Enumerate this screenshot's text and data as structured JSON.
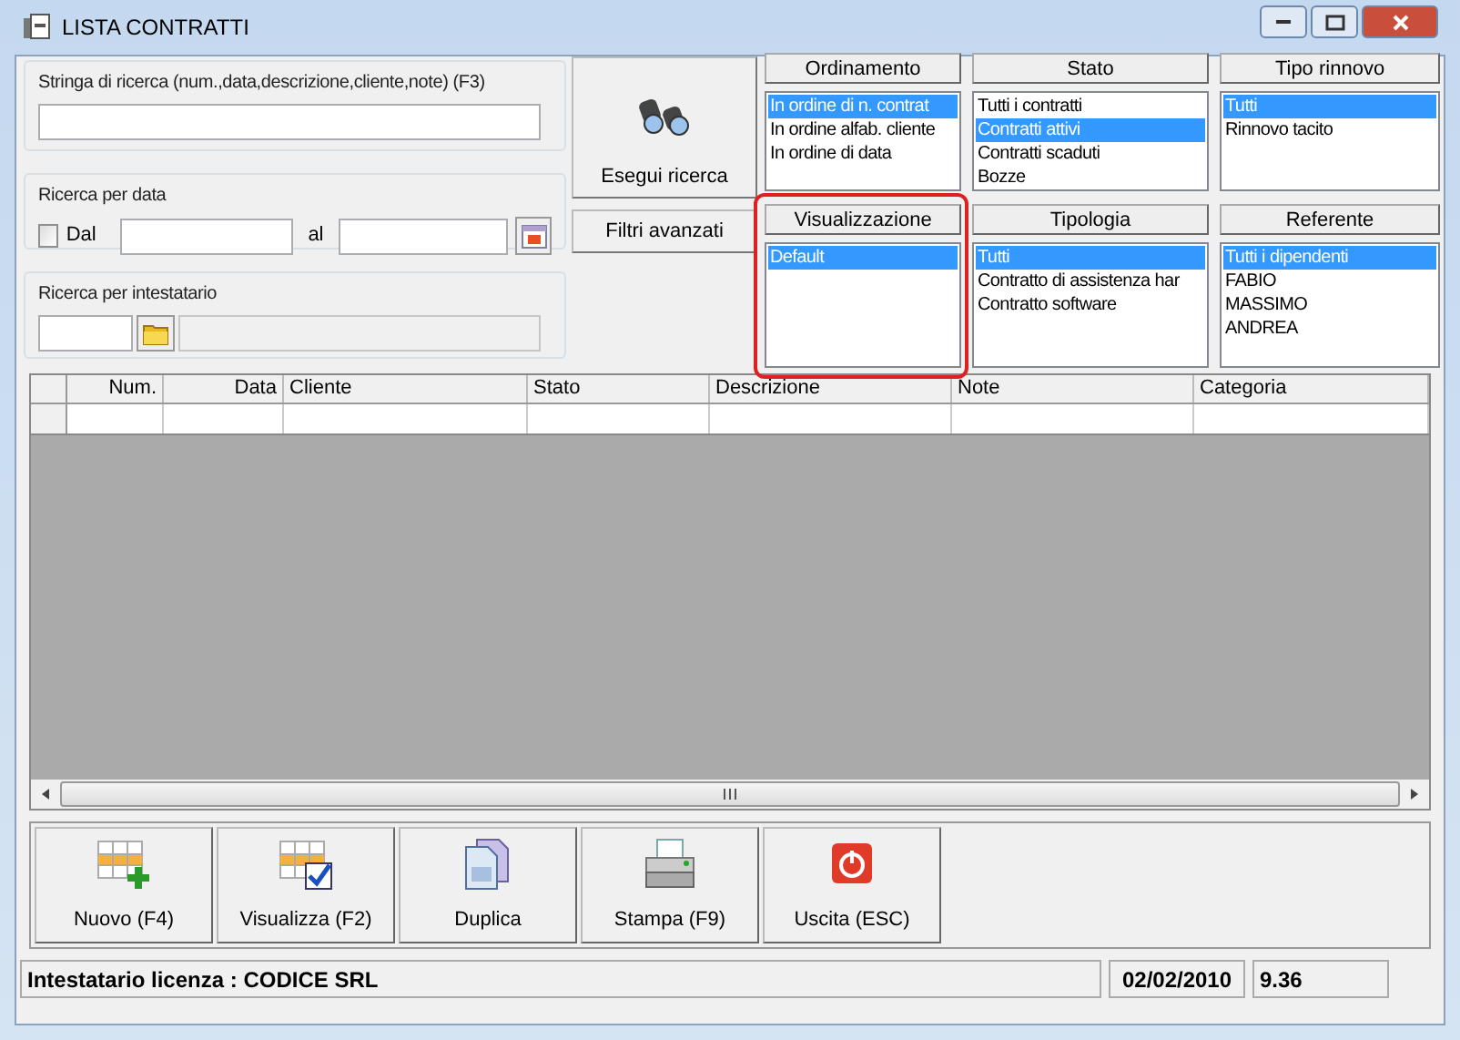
{
  "window": {
    "title": "LISTA CONTRATTI"
  },
  "search": {
    "label": "Stringa di ricerca (num.,data,descrizione,cliente,note) (F3)"
  },
  "date_search": {
    "label": "Ricerca per data",
    "checkbox_label": "Dal",
    "checked": false,
    "to_label": "al"
  },
  "holder_search": {
    "label": "Ricerca per intestatario"
  },
  "search_button": "Esegui ricerca",
  "advanced_button": "Filtri avanzati",
  "filters": [
    {
      "title": "Ordinamento",
      "highlighted": false,
      "items": [
        {
          "label": "In ordine di n. contrat",
          "selected": true
        },
        {
          "label": "In ordine alfab. cliente",
          "selected": false
        },
        {
          "label": "In ordine di data",
          "selected": false
        }
      ]
    },
    {
      "title": "Stato",
      "highlighted": false,
      "items": [
        {
          "label": "Tutti i contratti",
          "selected": false
        },
        {
          "label": "Contratti attivi",
          "selected": true
        },
        {
          "label": "Contratti scaduti",
          "selected": false
        },
        {
          "label": "Bozze",
          "selected": false
        }
      ]
    },
    {
      "title": "Tipo rinnovo",
      "highlighted": false,
      "items": [
        {
          "label": "Tutti",
          "selected": true
        },
        {
          "label": "Rinnovo tacito",
          "selected": false
        }
      ]
    },
    {
      "title": "Visualizzazione",
      "highlighted": true,
      "items": [
        {
          "label": "Default",
          "selected": true
        }
      ]
    },
    {
      "title": "Tipologia",
      "highlighted": false,
      "items": [
        {
          "label": "Tutti",
          "selected": true
        },
        {
          "label": "Contratto di assistenza har",
          "selected": false
        },
        {
          "label": "Contratto software",
          "selected": false
        }
      ]
    },
    {
      "title": "Referente",
      "highlighted": false,
      "items": [
        {
          "label": "Tutti i dipendenti",
          "selected": true
        },
        {
          "label": "FABIO",
          "selected": false
        },
        {
          "label": "MASSIMO",
          "selected": false
        },
        {
          "label": "ANDREA",
          "selected": false
        }
      ]
    }
  ],
  "table": {
    "columns": [
      "Num.",
      "Data",
      "Cliente",
      "Stato",
      "Descrizione",
      "Note",
      "Categoria"
    ]
  },
  "toolbar": [
    {
      "kind": "new",
      "label": "Nuovo (F4)"
    },
    {
      "kind": "view",
      "label": "Visualizza (F2)"
    },
    {
      "kind": "duplicate",
      "label": "Duplica"
    },
    {
      "kind": "print",
      "label": "Stampa (F9)"
    },
    {
      "kind": "exit",
      "label": "Uscita (ESC)"
    }
  ],
  "status_bar": {
    "license": "Intestatario licenza : CODICE SRL",
    "date": "02/02/2010",
    "version": "9.36"
  }
}
